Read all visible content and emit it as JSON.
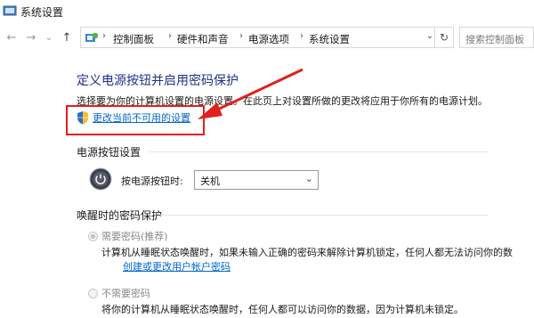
{
  "window": {
    "title": "系统设置"
  },
  "nav": {
    "back_glyph": "←",
    "forward_glyph": "→",
    "recent_glyph": "⌄",
    "up_glyph": "↑"
  },
  "address": {
    "crumbs": [
      "控制面板",
      "硬件和声音",
      "电源选项",
      "系统设置"
    ],
    "separator": "›",
    "chevron": "⌄",
    "refresh_glyph": "↻"
  },
  "search": {
    "placeholder": "搜索控制面板"
  },
  "page": {
    "title": "定义电源按钮并启用密码保护",
    "description": "选择要为你的计算机设置的电源设置。在此页上对设置所做的更改将应用于你所有的电源计划。",
    "change_link": "更改当前不可用的设置"
  },
  "power_section": {
    "title": "电源按钮设置",
    "label": "按电源按钮时:",
    "selected": "关机",
    "chevron": "⌄"
  },
  "password_section": {
    "title": "唤醒时的密码保护",
    "require": {
      "label": "需要密码(推荐)",
      "note": "计算机从睡眠状态唤醒时，如果未输入正确的密码来解除计算机锁定，任何人都无法访问你的数",
      "note_wrap": "据。",
      "link": "创建或更改用户帐户密码"
    },
    "no_require": {
      "label": "不需要密码",
      "note": "将你的计算机从睡眠状态唤醒时，任何人都可以访问你的数据，因为计算机未锁定。"
    }
  },
  "annotation": {
    "highlight_color": "#e0201b"
  }
}
